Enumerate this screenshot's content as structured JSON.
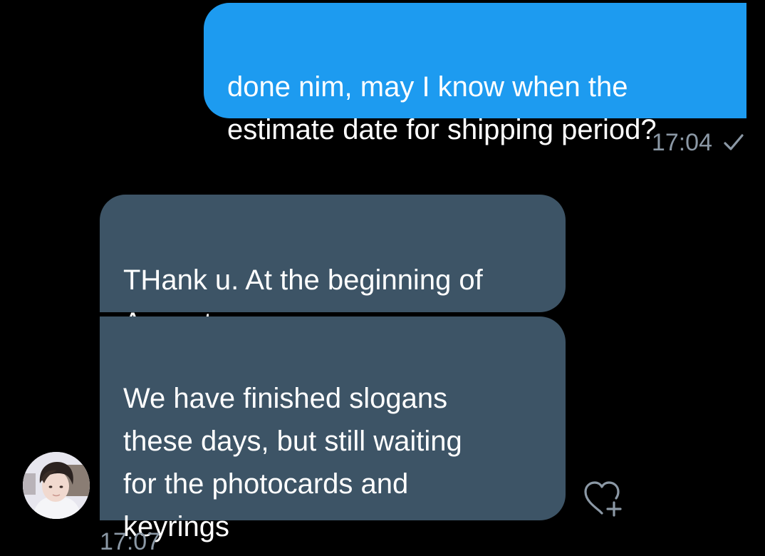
{
  "conversation": {
    "sent": [
      {
        "text": "done nim, may I know when the\nestimate date for shipping period?",
        "time": "17:04",
        "status_icon": "checkmark-icon"
      }
    ],
    "received": [
      {
        "text": "THank u. At the beginning of\nAugust~"
      },
      {
        "text": "We have finished slogans\nthese days, but still waiting\nfor the photocards and\nkeyrings",
        "time_partial": "17:07"
      }
    ],
    "react_icon": "heart-plus-icon",
    "avatar_icon": "avatar"
  },
  "colors": {
    "background": "#000000",
    "sent_bubble": "#1d9bf0",
    "received_bubble": "#3d5466",
    "meta_text": "#8b98a5"
  }
}
